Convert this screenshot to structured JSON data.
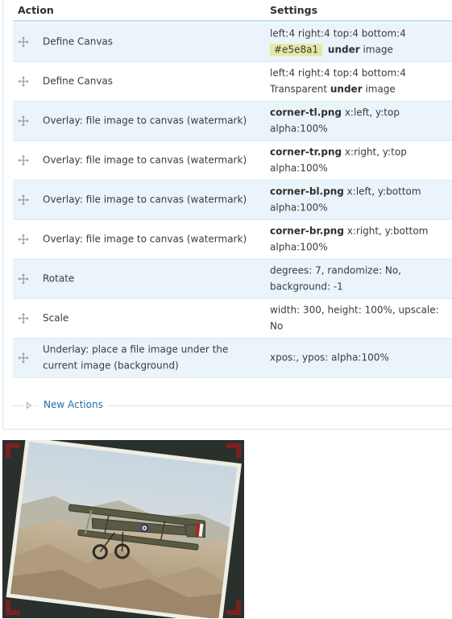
{
  "table": {
    "header_action": "Action",
    "header_settings": "Settings"
  },
  "rows": [
    {
      "action": "Define Canvas",
      "settings_line1": "left:4 right:4 top:4 bottom:4",
      "settings_swatch": "#e5e8a1",
      "settings_bold": "under",
      "settings_tail": "image"
    },
    {
      "action": "Define Canvas",
      "settings_line1": "left:4 right:4 top:4 bottom:4",
      "settings_pre": "Transparent",
      "settings_bold": "under",
      "settings_tail": "image"
    },
    {
      "action": "Overlay: file image to canvas (watermark)",
      "settings_bold": "corner-tl.png",
      "settings_rest": "x:left, y:top",
      "settings_line2": "alpha:100%"
    },
    {
      "action": "Overlay: file image to canvas (watermark)",
      "settings_bold": "corner-tr.png",
      "settings_rest": "x:right, y:top",
      "settings_line2": "alpha:100%"
    },
    {
      "action": "Overlay: file image to canvas (watermark)",
      "settings_bold": "corner-bl.png",
      "settings_rest": "x:left, y:bottom",
      "settings_line2": "alpha:100%"
    },
    {
      "action": "Overlay: file image to canvas (watermark)",
      "settings_bold": "corner-br.png",
      "settings_rest": "x:right, y:bottom",
      "settings_line2": "alpha:100%"
    },
    {
      "action": "Rotate",
      "settings_text": "degrees: 7, randomize: No, background: -1"
    },
    {
      "action": "Scale",
      "settings_text": "width: 300, height: 100%, upscale: No"
    },
    {
      "action": "Underlay: place a file image under the current image (background)",
      "settings_text": "xpos:, ypos: alpha:100%"
    }
  ],
  "new_actions": {
    "label": "New Actions",
    "icon": "triangle-right-icon"
  },
  "colors": {
    "header_rule": "#bfe0f2",
    "row_alt": "#ebf4fa",
    "swatch": "#e5e8a1",
    "link": "#1f6ea8"
  }
}
